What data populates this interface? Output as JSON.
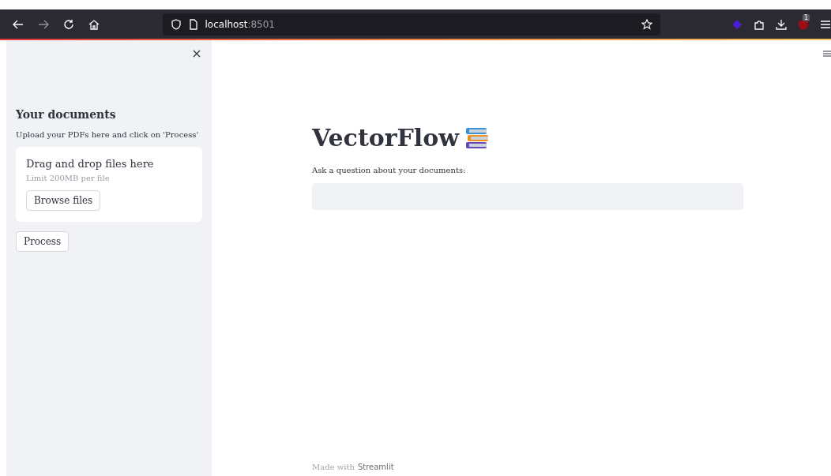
{
  "browser": {
    "address_host": "localhost",
    "address_port": ":8501",
    "extension_badge": "1"
  },
  "sidebar": {
    "header": "Your documents",
    "caption": "Upload your PDFs here and click on 'Process'",
    "uploader": {
      "title": "Drag and drop files here",
      "limit": "Limit 200MB per file",
      "button": "Browse files"
    },
    "process_button": "Process"
  },
  "main": {
    "title": "VectorFlow",
    "question_label": "Ask a question about your documents:",
    "footer": {
      "text": "Made with",
      "link": "Streamlit"
    }
  }
}
